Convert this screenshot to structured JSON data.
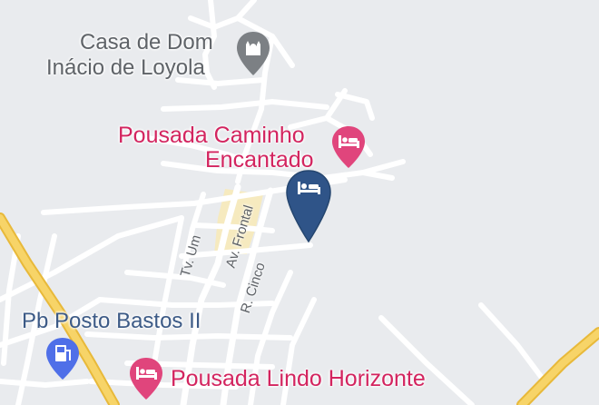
{
  "map": {
    "places": {
      "casa_dom_inacio": {
        "line1": "Casa de Dom",
        "line2": "Inácio de Loyola",
        "icon": "church-icon"
      },
      "pousada_caminho": {
        "line1": "Pousada Caminho",
        "line2": "Encantado",
        "icon": "hotel-icon"
      },
      "pb_posto_bastos": {
        "line1": "Pb Posto Bastos II",
        "icon": "gas-station-icon"
      },
      "pousada_lindo": {
        "line1": "Pousada Lindo Horizonte",
        "icon": "hotel-icon"
      }
    },
    "streets": {
      "tv_um": "Tv. Um",
      "av_frontal": "Av. Frontal",
      "r_cinco": "R. Cinco"
    },
    "marker": {
      "icon": "hotel-pin-icon",
      "color": "#2f5488"
    },
    "colors": {
      "background": "#e9ebee",
      "road": "#ffffff",
      "highway": "#f5cf57",
      "commercial": "#f6eabf",
      "poi_pink": "#d3245f",
      "poi_gray": "#5f6368"
    }
  }
}
